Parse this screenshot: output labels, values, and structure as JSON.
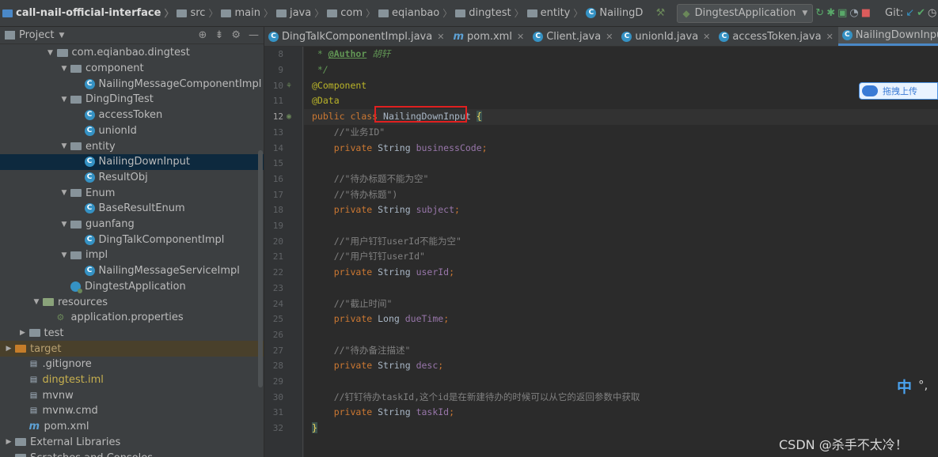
{
  "navbar": {
    "crumbs": [
      "call-nail-official-interface",
      "src",
      "main",
      "java",
      "com",
      "eqianbao",
      "dingtest",
      "entity",
      "NailingD"
    ],
    "run_config": "DingtestApplication",
    "git_label": "Git:",
    "icons": [
      "hammer-icon",
      "rerun-icon",
      "debug-icon",
      "coverage-icon",
      "profile-icon",
      "stop-icon",
      "git-update-icon",
      "git-commit-icon",
      "history-icon",
      "rollback-icon",
      "project-structure-icon"
    ]
  },
  "project": {
    "header": "Project",
    "tree": [
      {
        "label": "com.eqianbao.dingtest",
        "type": "package",
        "depth": 3,
        "expanded": true
      },
      {
        "label": "component",
        "type": "package",
        "depth": 4,
        "expanded": true
      },
      {
        "label": "NailingMessageComponentImpl",
        "type": "class",
        "depth": 5
      },
      {
        "label": "DingDingTest",
        "type": "package",
        "depth": 4,
        "expanded": true
      },
      {
        "label": "accessToken",
        "type": "class",
        "depth": 5
      },
      {
        "label": "unionId",
        "type": "class",
        "depth": 5
      },
      {
        "label": "entity",
        "type": "package",
        "depth": 4,
        "expanded": true
      },
      {
        "label": "NailingDownInput",
        "type": "class",
        "depth": 5,
        "selected": true
      },
      {
        "label": "ResultObj",
        "type": "class",
        "depth": 5
      },
      {
        "label": "Enum",
        "type": "package",
        "depth": 4,
        "expanded": true
      },
      {
        "label": "BaseResultEnum",
        "type": "class",
        "depth": 5
      },
      {
        "label": "guanfang",
        "type": "package",
        "depth": 4,
        "expanded": true
      },
      {
        "label": "DingTalkComponentImpl",
        "type": "class",
        "depth": 5
      },
      {
        "label": "impl",
        "type": "package",
        "depth": 4,
        "expanded": true
      },
      {
        "label": "NailingMessageServiceImpl",
        "type": "class",
        "depth": 5
      },
      {
        "label": "DingtestApplication",
        "type": "spring",
        "depth": 4
      },
      {
        "label": "resources",
        "type": "resfolder",
        "depth": 2,
        "expanded": true
      },
      {
        "label": "application.properties",
        "type": "props",
        "depth": 3
      },
      {
        "label": "test",
        "type": "folder",
        "depth": 1,
        "expanded": false
      },
      {
        "label": "target",
        "type": "target",
        "depth": 0,
        "expanded": false
      },
      {
        "label": ".gitignore",
        "type": "file",
        "depth": 1
      },
      {
        "label": "dingtest.iml",
        "type": "iml",
        "depth": 1
      },
      {
        "label": "mvnw",
        "type": "file",
        "depth": 1
      },
      {
        "label": "mvnw.cmd",
        "type": "file",
        "depth": 1
      },
      {
        "label": "pom.xml",
        "type": "maven",
        "depth": 1
      },
      {
        "label": "External Libraries",
        "type": "libs",
        "depth": 0,
        "expanded": false
      },
      {
        "label": "Scratches and Consoles",
        "type": "scratch",
        "depth": 0
      }
    ]
  },
  "tabs": [
    {
      "label": "DingTalkComponentImpl.java",
      "icon": "c",
      "active": false
    },
    {
      "label": "pom.xml",
      "icon": "m",
      "active": false
    },
    {
      "label": "Client.java",
      "icon": "c",
      "active": false
    },
    {
      "label": "unionId.java",
      "icon": "c",
      "active": false
    },
    {
      "label": "accessToken.java",
      "icon": "c",
      "active": false
    },
    {
      "label": "NailingDownInput.java",
      "icon": "c",
      "active": true
    }
  ],
  "editor": {
    "lines": [
      {
        "n": "8",
        "tokens": [
          [
            " * ",
            "doc"
          ],
          [
            "@Author",
            "doctag"
          ],
          [
            " ",
            "doc"
          ],
          [
            "胡轩",
            "doc"
          ]
        ]
      },
      {
        "n": "9",
        "tokens": [
          [
            " */",
            "doc"
          ]
        ]
      },
      {
        "n": "10",
        "tokens": [
          [
            "@Component",
            "ann"
          ]
        ],
        "mark": "bean"
      },
      {
        "n": "11",
        "tokens": [
          [
            "@Data",
            "ann"
          ]
        ]
      },
      {
        "n": "12",
        "tokens": [
          [
            "public ",
            "kw"
          ],
          [
            "class ",
            "kw"
          ],
          [
            "NailingDownInput ",
            "plain"
          ],
          [
            "{",
            "brace"
          ]
        ],
        "mark": "spring",
        "current": true
      },
      {
        "n": "13",
        "tokens": [
          [
            "    //\"业务ID\"",
            "cm"
          ]
        ]
      },
      {
        "n": "14",
        "tokens": [
          [
            "    ",
            "plain"
          ],
          [
            "private ",
            "kw"
          ],
          [
            "String ",
            "plain"
          ],
          [
            "businessCode",
            "field"
          ],
          [
            ";",
            "kw"
          ]
        ]
      },
      {
        "n": "15",
        "tokens": []
      },
      {
        "n": "16",
        "tokens": [
          [
            "    //\"待办标题不能为空\"",
            "cm"
          ]
        ]
      },
      {
        "n": "17",
        "tokens": [
          [
            "    //\"待办标题\")",
            "cm"
          ]
        ]
      },
      {
        "n": "18",
        "tokens": [
          [
            "    ",
            "plain"
          ],
          [
            "private ",
            "kw"
          ],
          [
            "String ",
            "plain"
          ],
          [
            "subject",
            "field"
          ],
          [
            ";",
            "kw"
          ]
        ]
      },
      {
        "n": "19",
        "tokens": []
      },
      {
        "n": "20",
        "tokens": [
          [
            "    //\"用户钉钉userId不能为空\"",
            "cm"
          ]
        ]
      },
      {
        "n": "21",
        "tokens": [
          [
            "    //\"用户钉钉userId\"",
            "cm"
          ]
        ]
      },
      {
        "n": "22",
        "tokens": [
          [
            "    ",
            "plain"
          ],
          [
            "private ",
            "kw"
          ],
          [
            "String ",
            "plain"
          ],
          [
            "userId",
            "field"
          ],
          [
            ";",
            "kw"
          ]
        ]
      },
      {
        "n": "23",
        "tokens": []
      },
      {
        "n": "24",
        "tokens": [
          [
            "    //\"截止时间\"",
            "cm"
          ]
        ]
      },
      {
        "n": "25",
        "tokens": [
          [
            "    ",
            "plain"
          ],
          [
            "private ",
            "kw"
          ],
          [
            "Long ",
            "plain"
          ],
          [
            "dueTime",
            "field"
          ],
          [
            ";",
            "kw"
          ]
        ]
      },
      {
        "n": "26",
        "tokens": []
      },
      {
        "n": "27",
        "tokens": [
          [
            "    //\"待办备注描述\"",
            "cm"
          ]
        ]
      },
      {
        "n": "28",
        "tokens": [
          [
            "    ",
            "plain"
          ],
          [
            "private ",
            "kw"
          ],
          [
            "String ",
            "plain"
          ],
          [
            "desc",
            "field"
          ],
          [
            ";",
            "kw"
          ]
        ]
      },
      {
        "n": "29",
        "tokens": []
      },
      {
        "n": "30",
        "tokens": [
          [
            "    //钉钉待办taskId,这个id是在新建待办的时候可以从它的返回参数中获取",
            "cm"
          ]
        ]
      },
      {
        "n": "31",
        "tokens": [
          [
            "    ",
            "plain"
          ],
          [
            "private ",
            "kw"
          ],
          [
            "String ",
            "plain"
          ],
          [
            "taskId",
            "field"
          ],
          [
            ";",
            "kw"
          ]
        ]
      },
      {
        "n": "32",
        "tokens": [
          [
            "}",
            "brace"
          ]
        ]
      }
    ]
  },
  "overlay": {
    "upload_label": "拖拽上传",
    "ime_label": "中",
    "ime_extra": "°,",
    "watermark": "CSDN @杀手不太冷！"
  }
}
